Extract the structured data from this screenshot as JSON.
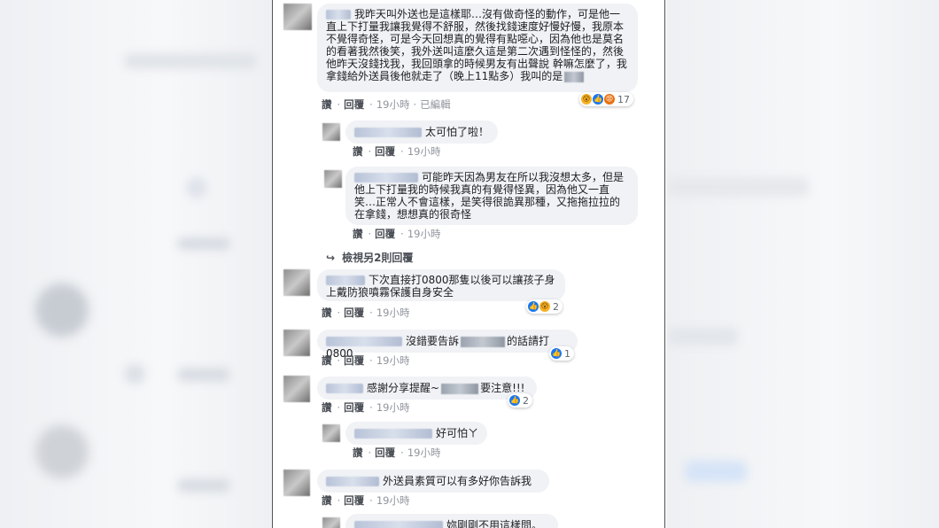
{
  "colors": {
    "link": "#1877f2",
    "bubble": "#f0f2f5",
    "meta": "#90949c"
  },
  "actions": {
    "like": "讚",
    "reply": "回覆",
    "sep": "·"
  },
  "comments": [
    {
      "text": "我昨天叫外送也是這樣耶…沒有做奇怪的動作，可是他一直上下打量我讓我覺得不舒服，然後找錢速度好慢好慢，我原本不覺得奇怪，可是今天回想真的覺得有點噁心，因為他也是莫名的看著我然後笑，我外送叫這麼久這是第二次遇到怪怪的，然後他昨天沒錢找我，我回頭拿的時候男友有出聲說 幹嘛怎麼了，我拿錢給外送員後他就走了（晚上11點多）我叫的是",
      "time": "19小時",
      "edited": "已編輯",
      "reaction_count": "17"
    },
    {
      "text": "太可怕了啦！",
      "time": "19小時"
    },
    {
      "text": "可能昨天因為男友在所以我沒想太多，但是他上下打量我的時候我真的有覺得怪異，因為他又一直笑…正常人不會這樣，是笑得很詭異那種，又拖拖拉拉的在拿錢，想想真的很奇怪",
      "time": "19小時"
    },
    {
      "view_more": "檢視另2則回覆"
    },
    {
      "text": "下次直接打0800那隻以後可以讓孩子身上戴防狼噴霧保護自身安全",
      "time": "19小時",
      "reaction_count": "2"
    },
    {
      "text_a": "沒錯要告訴",
      "text_b": "的話請打0800",
      "time": "19小時",
      "reaction_count": "1"
    },
    {
      "text_a": "感謝分享提醒~",
      "text_b": "要注意!!!",
      "time": "19小時",
      "reaction_count": "2"
    },
    {
      "text": "好可怕ㄚ",
      "time": "19小時"
    },
    {
      "text": "外送員素質可以有多好你告訴我",
      "time": "19小時"
    },
    {
      "text": "妳剛剛不用這樣問。"
    }
  ]
}
